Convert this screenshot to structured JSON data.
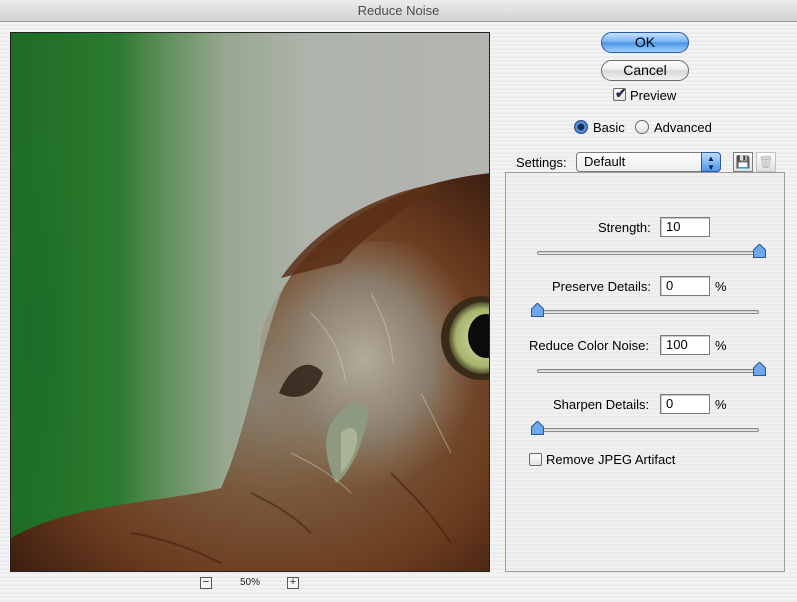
{
  "window": {
    "title": "Reduce Noise"
  },
  "preview": {
    "zoom_label": "50%",
    "zoom_out_glyph": "−",
    "zoom_in_glyph": "+"
  },
  "buttons": {
    "ok": "OK",
    "cancel": "Cancel"
  },
  "preview_toggle": {
    "label": "Preview",
    "checked": true
  },
  "mode": {
    "basic": "Basic",
    "advanced": "Advanced",
    "selected": "Basic"
  },
  "settings": {
    "label": "Settings:",
    "selected": "Default",
    "save_icon": "save-icon",
    "delete_icon": "trash-icon"
  },
  "controls": [
    {
      "label": "Strength:",
      "value": "10",
      "unit": "",
      "slider_fraction": 1.0
    },
    {
      "label": "Preserve Details:",
      "value": "0",
      "unit": "%",
      "slider_fraction": 0.0
    },
    {
      "label": "Reduce Color Noise:",
      "value": "100",
      "unit": "%",
      "slider_fraction": 1.0
    },
    {
      "label": "Sharpen Details:",
      "value": "0",
      "unit": "%",
      "slider_fraction": 0.0
    }
  ],
  "jpeg": {
    "label": "Remove JPEG Artifact",
    "checked": false
  },
  "colors": {
    "accent": "#4c95e5",
    "background": "#ececec"
  }
}
